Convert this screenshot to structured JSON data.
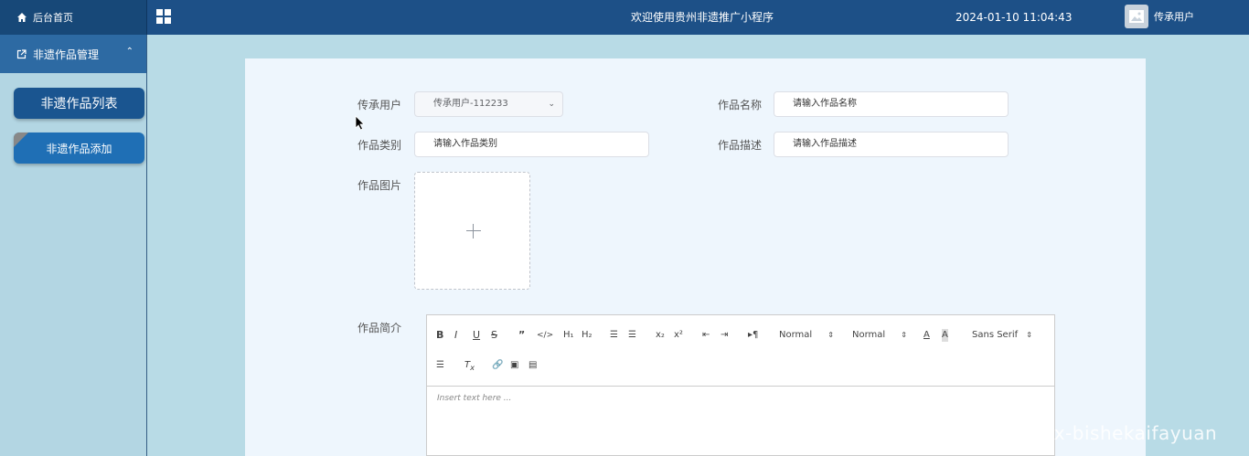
{
  "header": {
    "home_label": "后台首页",
    "title": "欢迎使用贵州非遗推广小程序",
    "datetime": "2024-01-10 11:04:43",
    "user_name": "传承用户"
  },
  "sidebar": {
    "group_label": "非遗作品管理",
    "items": [
      {
        "label": "非遗作品列表"
      },
      {
        "label": "非遗作品添加"
      }
    ]
  },
  "form": {
    "user_label": "传承用户",
    "user_value": "传承用户-112233",
    "name_label": "作品名称",
    "name_placeholder": "请输入作品名称",
    "category_label": "作品类别",
    "category_placeholder": "请输入作品类别",
    "desc_label": "作品描述",
    "desc_placeholder": "请输入作品描述",
    "image_label": "作品图片",
    "intro_label": "作品简介"
  },
  "editor": {
    "header_select": "Normal",
    "size_select": "Normal",
    "font_select": "Sans Serif",
    "placeholder": "Insert text here ..."
  },
  "watermark": "CSDN @vx-bishekaifayuan",
  "colors": {
    "topbar": "#1d5087",
    "sidebar": "#b3d6e3",
    "active_menu": "#1a5590",
    "panel": "#eef6fd"
  }
}
